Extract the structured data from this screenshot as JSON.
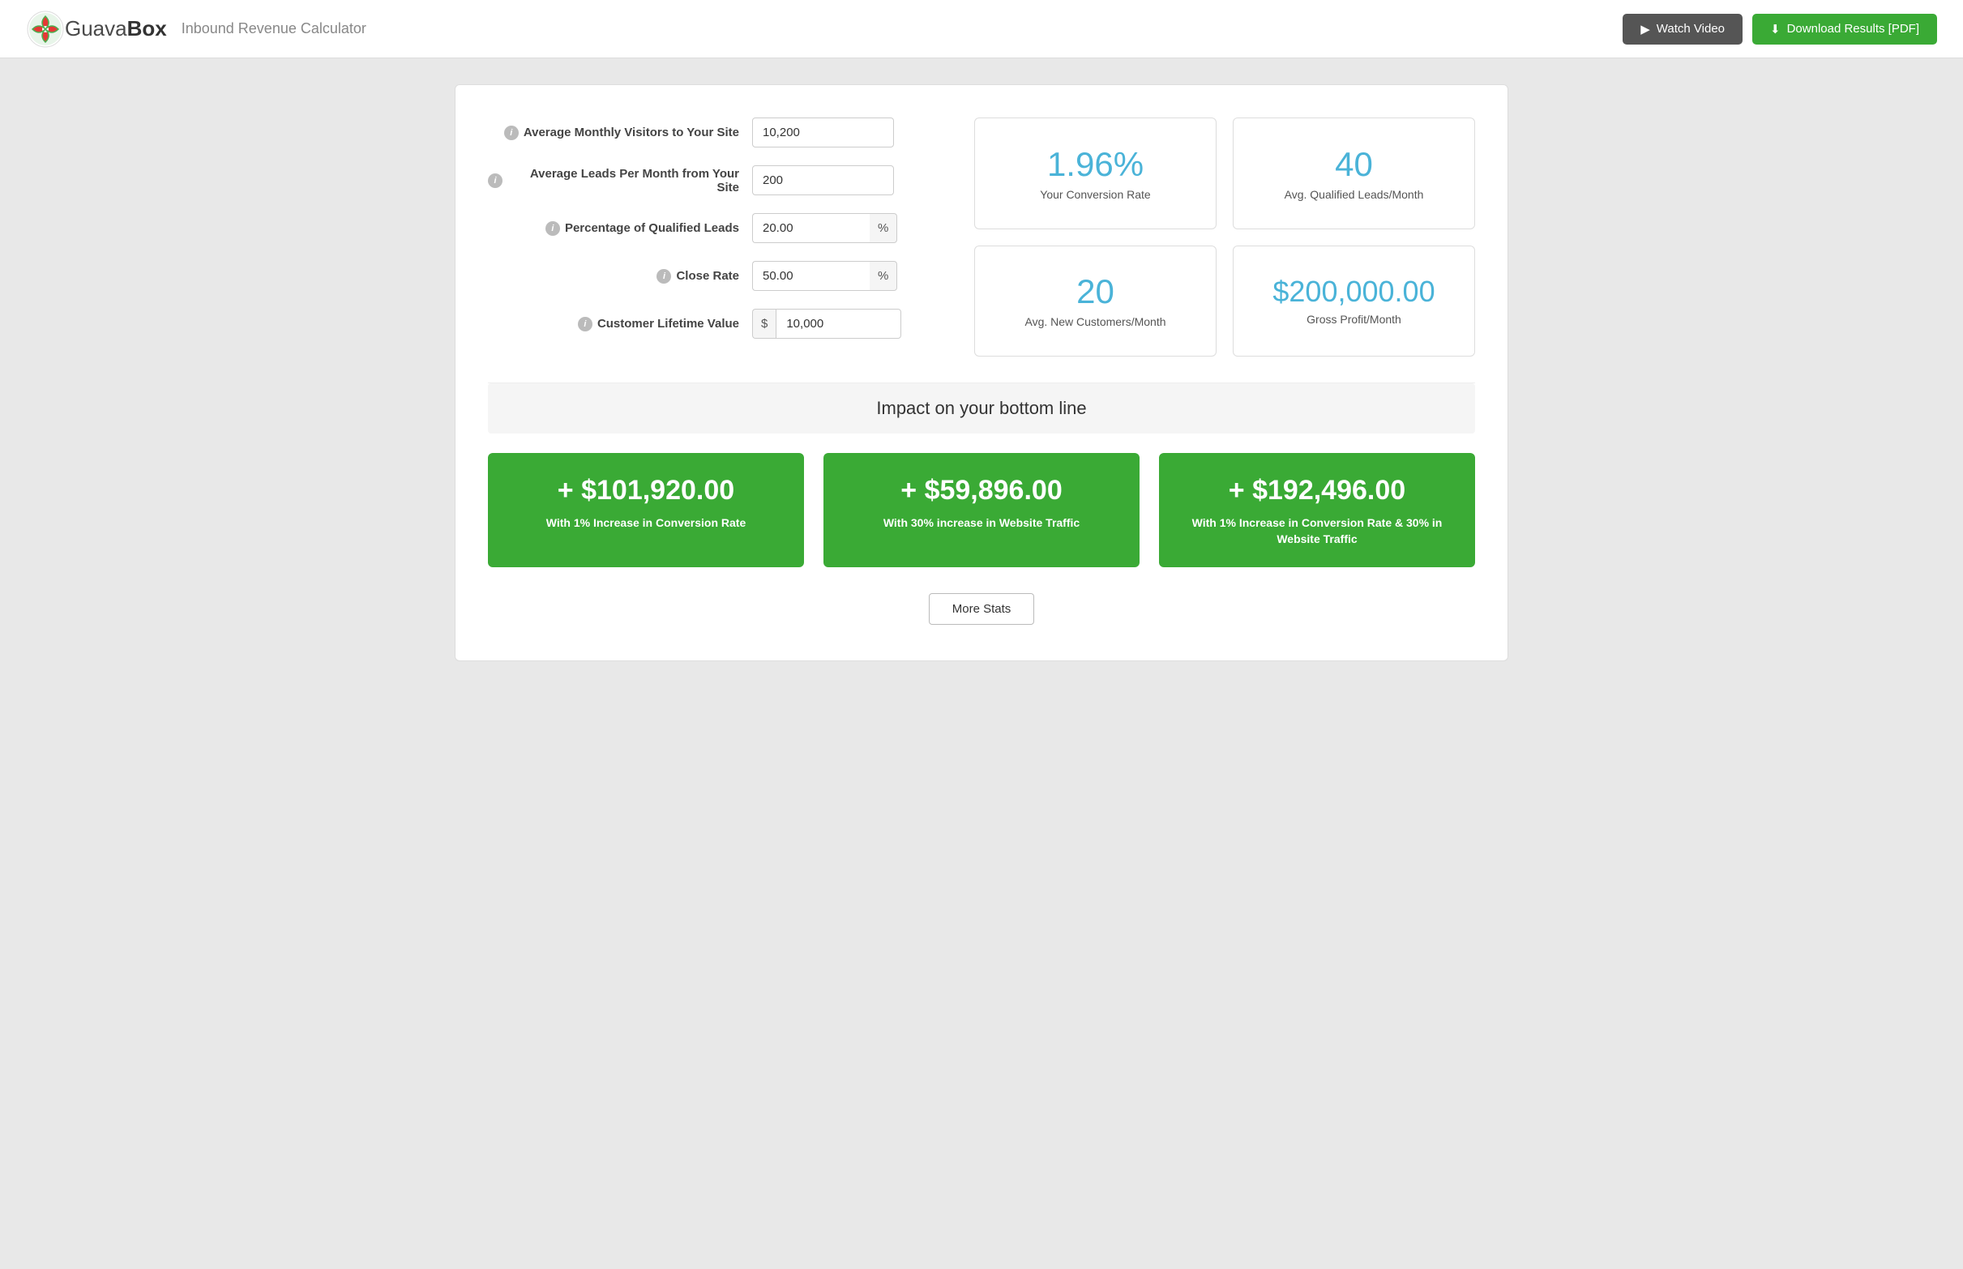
{
  "header": {
    "brand": "GuavaBox",
    "subtitle": "Inbound Revenue Calculator",
    "watch_video_label": "Watch Video",
    "download_label": "Download Results [PDF]"
  },
  "inputs": [
    {
      "id": "monthly-visitors",
      "label": "Average Monthly Visitors to Your Site",
      "value": "10,200",
      "type": "plain"
    },
    {
      "id": "monthly-leads",
      "label": "Average Leads Per Month from Your Site",
      "value": "200",
      "type": "plain"
    },
    {
      "id": "qualified-leads",
      "label": "Percentage of Qualified Leads",
      "value": "20.00",
      "type": "suffix",
      "suffix": "%"
    },
    {
      "id": "close-rate",
      "label": "Close Rate",
      "value": "50.00",
      "type": "suffix",
      "suffix": "%"
    },
    {
      "id": "lifetime-value",
      "label": "Customer Lifetime Value",
      "value": "10,000",
      "type": "prefix",
      "prefix": "$"
    }
  ],
  "stats": [
    {
      "id": "conversion-rate",
      "value": "1.96%",
      "label": "Your Conversion Rate",
      "size": "large"
    },
    {
      "id": "qualified-leads-month",
      "value": "40",
      "label": "Avg. Qualified Leads/Month",
      "size": "large"
    },
    {
      "id": "new-customers",
      "value": "20",
      "label": "Avg. New Customers/Month",
      "size": "large"
    },
    {
      "id": "gross-profit",
      "value": "$200,000.00",
      "label": "Gross Profit/Month",
      "size": "medium"
    }
  ],
  "impact": {
    "heading": "Impact on your bottom line",
    "cards": [
      {
        "id": "conversion-rate-increase",
        "value": "+ $101,920.00",
        "description": "With 1% Increase in Conversion Rate"
      },
      {
        "id": "traffic-increase",
        "value": "+ $59,896.00",
        "description": "With 30% increase in Website Traffic"
      },
      {
        "id": "combined-increase",
        "value": "+ $192,496.00",
        "description": "With 1% Increase in Conversion Rate & 30% in Website Traffic"
      }
    ]
  },
  "more_stats_label": "More Stats"
}
